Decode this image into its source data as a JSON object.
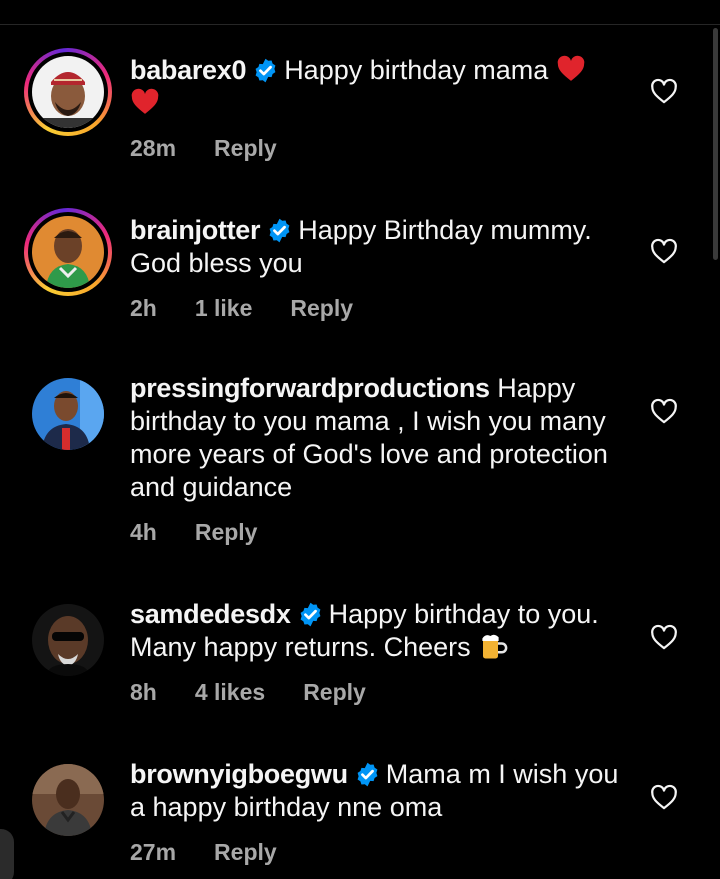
{
  "comments": [
    {
      "username": "babarex0",
      "verified": true,
      "text": "Happy birthday mama",
      "time": "28m",
      "likes": "",
      "reply_label": "Reply",
      "avatar_icon": "avatar-man-red-cap"
    },
    {
      "username": "brainjotter",
      "verified": true,
      "text": "Happy Birthday mummy. God bless you",
      "time": "2h",
      "likes": "1 like",
      "reply_label": "Reply",
      "avatar_icon": "avatar-man-orange-bg"
    },
    {
      "username": "pressingforwardproductions",
      "verified": false,
      "text": "Happy birthday to you mama , I wish you many more years of God's love and protection and guidance",
      "time": "4h",
      "likes": "",
      "reply_label": "Reply",
      "avatar_icon": "avatar-man-blue-bg"
    },
    {
      "username": "samdedesdx",
      "verified": true,
      "text": "Happy birthday to you. Many happy returns. Cheers",
      "time": "8h",
      "likes": "4 likes",
      "reply_label": "Reply",
      "avatar_icon": "avatar-man-sunglasses"
    },
    {
      "username": "brownyigboegwu",
      "verified": true,
      "text": "Mama m I wish you a happy birthday nne oma",
      "time": "27m",
      "likes": "",
      "reply_label": "Reply",
      "avatar_icon": "avatar-man-brown-bg"
    }
  ],
  "colors": {
    "background": "#000000",
    "text": "#f5f5f5",
    "meta": "#a8a8a8",
    "verified": "#0095f6",
    "heart_emoji": "#e0242c"
  }
}
